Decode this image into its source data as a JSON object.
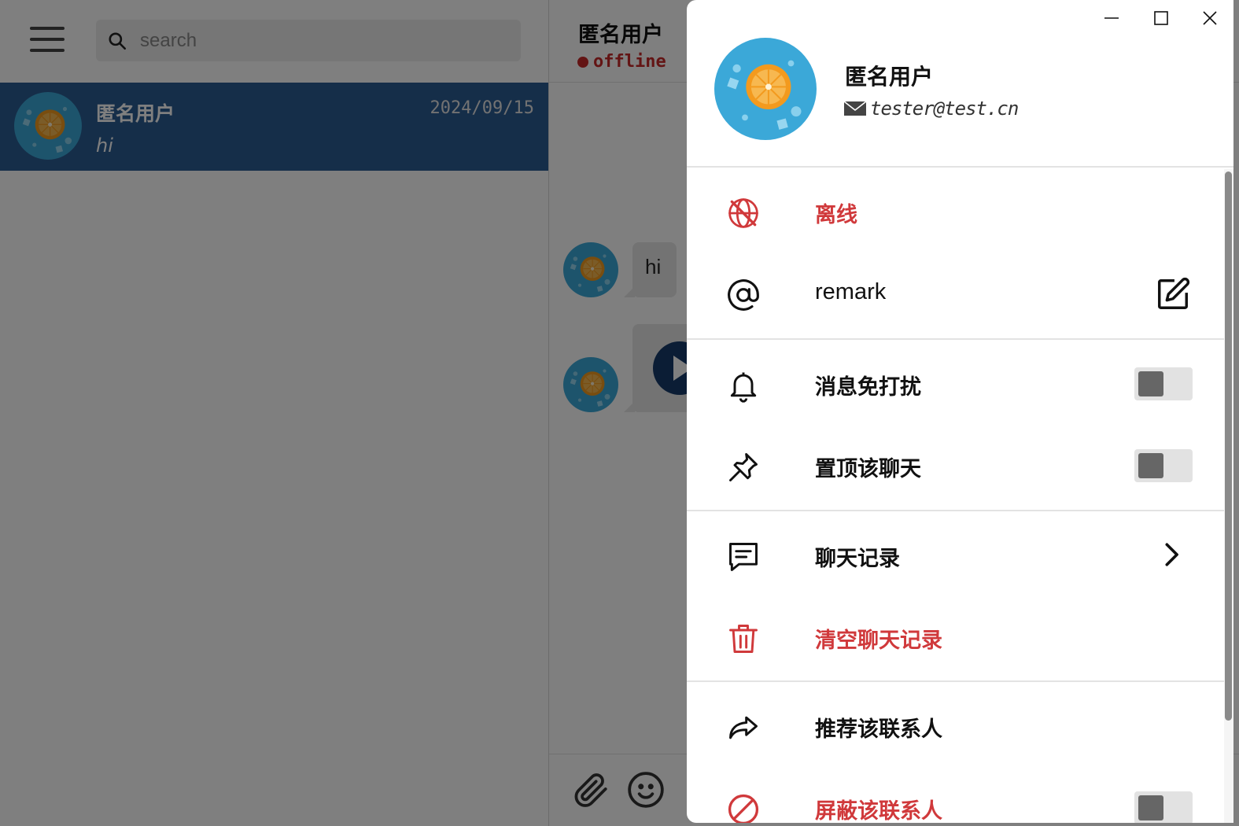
{
  "search": {
    "placeholder": "search"
  },
  "chat_list": [
    {
      "name": "匿名用户",
      "date": "2024/09/15",
      "preview": "hi"
    }
  ],
  "chat_header": {
    "title": "匿名用户",
    "status": "offline"
  },
  "messages": [
    {
      "type": "text",
      "text": "hi"
    },
    {
      "type": "voice"
    }
  ],
  "profile": {
    "name": "匿名用户",
    "email": "tester@test.cn"
  },
  "menu": {
    "offline_label": "离线",
    "remark_label": "remark",
    "mute_label": "消息免打扰",
    "mute_on": false,
    "pin_label": "置顶该聊天",
    "pin_on": false,
    "history_label": "聊天记录",
    "clear_label": "清空聊天记录",
    "recommend_label": "推荐该联系人",
    "block_label": "屏蔽该联系人",
    "block_on": false
  },
  "icons": {
    "window": [
      "minimize-icon",
      "maximize-icon",
      "close-icon"
    ],
    "menu": [
      "offline-globe-icon",
      "at-icon",
      "edit-icon",
      "bell-icon",
      "pin-icon",
      "chat-history-icon",
      "chevron-right-icon",
      "trash-icon",
      "share-icon",
      "block-icon"
    ],
    "composer": [
      "paperclip-icon",
      "emoji-icon"
    ]
  },
  "colors": {
    "accent_selected": "#2b5c92",
    "danger": "#d0393b",
    "status_offline": "#c62828",
    "avatar_bg": "#3ba8d8",
    "orange": "#f39a1e",
    "voice_button": "#163a6a"
  }
}
